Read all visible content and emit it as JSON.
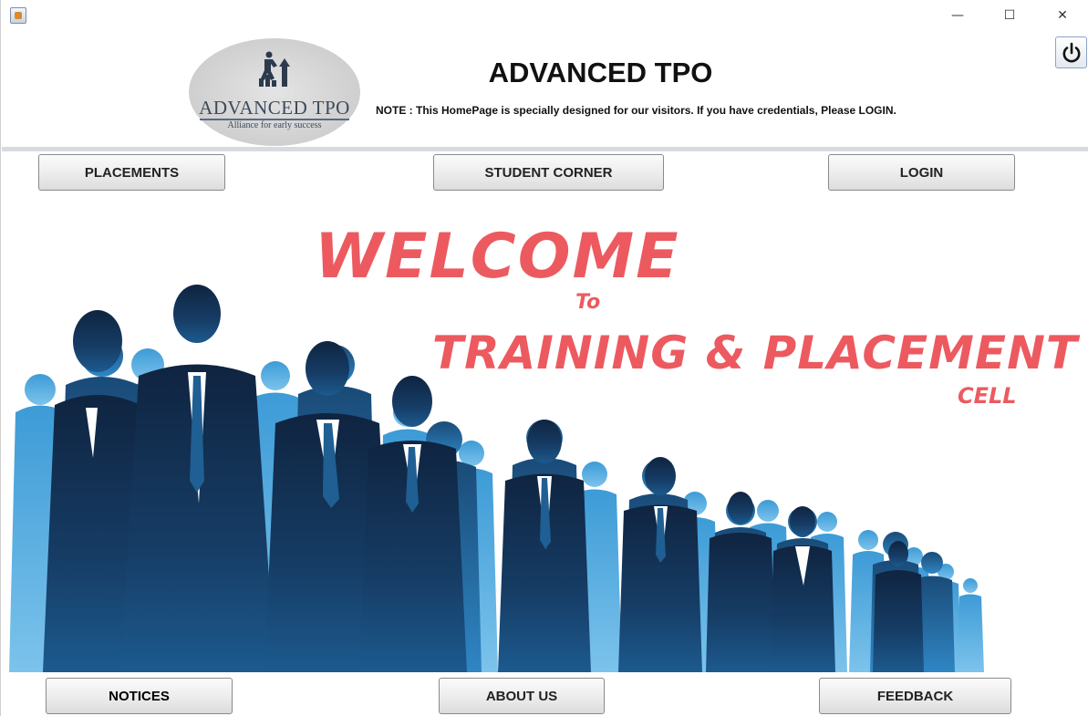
{
  "window": {
    "minimize_glyph": "—",
    "maximize_glyph": "☐",
    "close_glyph": "✕"
  },
  "header": {
    "title": "ADVANCED TPO",
    "note": "NOTE : This HomePage is specially designed for our visitors. If you have credentials, Please LOGIN.",
    "logo_title": "ADVANCED TPO",
    "logo_tagline": "Alliance for early success"
  },
  "nav_top": {
    "placements": "PLACEMENTS",
    "student_corner": "STUDENT CORNER",
    "login": "LOGIN"
  },
  "hero": {
    "line1": "WELCOME",
    "line2": "To",
    "line3": "TRAINING  &  PLACEMENT",
    "line4": "CELL"
  },
  "nav_bottom": {
    "notices": "NOTICES",
    "about_us": "ABOUT US",
    "feedback": "FEEDBACK"
  },
  "colors": {
    "welcome_text": "#ec5a5f",
    "silhouette_dark": "#0f2440",
    "silhouette_mid": "#1c5a8e",
    "silhouette_light": "#3d9bd6"
  },
  "icons": {
    "power": "power-icon",
    "app": "java-app-icon",
    "logo": "growth-chart-icon"
  }
}
